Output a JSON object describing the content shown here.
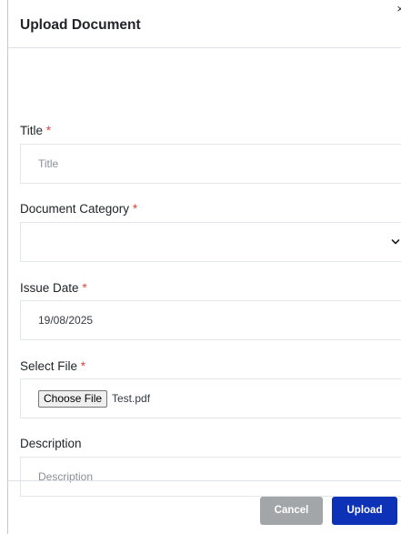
{
  "modal": {
    "title": "Upload Document",
    "close_glyph": "×"
  },
  "form": {
    "title": {
      "label": "Title",
      "required_marker": "*",
      "placeholder": "Title",
      "value": ""
    },
    "category": {
      "label": "Document Category",
      "required_marker": "*",
      "selected": "",
      "icon": "chevron-down-icon"
    },
    "issue_date": {
      "label": "Issue Date",
      "required_marker": "*",
      "value": "19/08/2025"
    },
    "file": {
      "label": "Select File",
      "required_marker": "*",
      "button_label": "Choose File",
      "file_name": "Test.pdf"
    },
    "description": {
      "label": "Description",
      "placeholder": "Description",
      "value": ""
    }
  },
  "footer": {
    "cancel_label": "Cancel",
    "upload_label": "Upload"
  },
  "colors": {
    "required": "#e0453a",
    "primary": "#0d31b7",
    "secondary": "#a3a6a9"
  }
}
